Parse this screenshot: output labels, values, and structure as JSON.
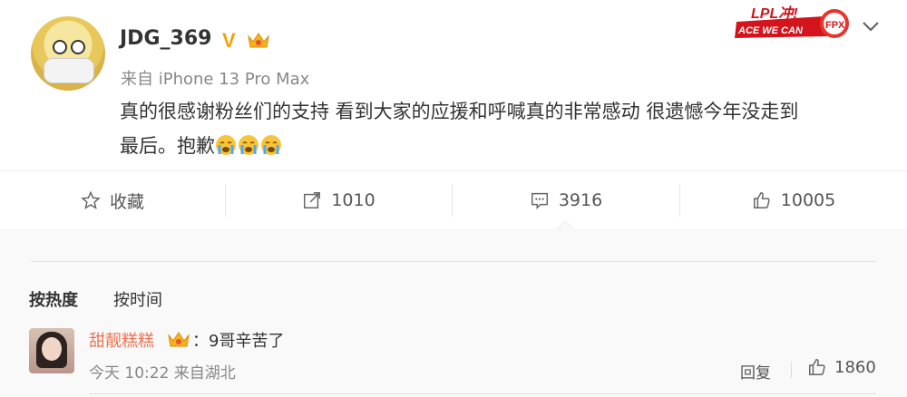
{
  "post": {
    "username": "JDG_369",
    "verified_badge": "V",
    "source": "来自 iPhone 13 Pro Max",
    "content_line1": "真的很感谢粉丝们的支持 看到大家的应援和呼喊真的非常感动 很遗憾今年没走到",
    "content_line2": "最后。抱歉",
    "banner_text": "ACE WE CAN",
    "banner_lpl": "LPL冲!",
    "banner_team": "FPX"
  },
  "toolbar": {
    "favorite_label": "收藏",
    "repost_count": "1010",
    "comment_count": "3916",
    "like_count": "10005"
  },
  "comments": {
    "sort_hot": "按热度",
    "sort_time": "按时间",
    "items": [
      {
        "author": "甜靓糕糕",
        "text": "：9哥辛苦了",
        "time": "今天 10:22 来自湖北",
        "reply_label": "回复",
        "likes": "1860"
      }
    ]
  },
  "colors": {
    "accent": "#eb7350",
    "verified": "#f0a30a",
    "muted": "#888888"
  }
}
